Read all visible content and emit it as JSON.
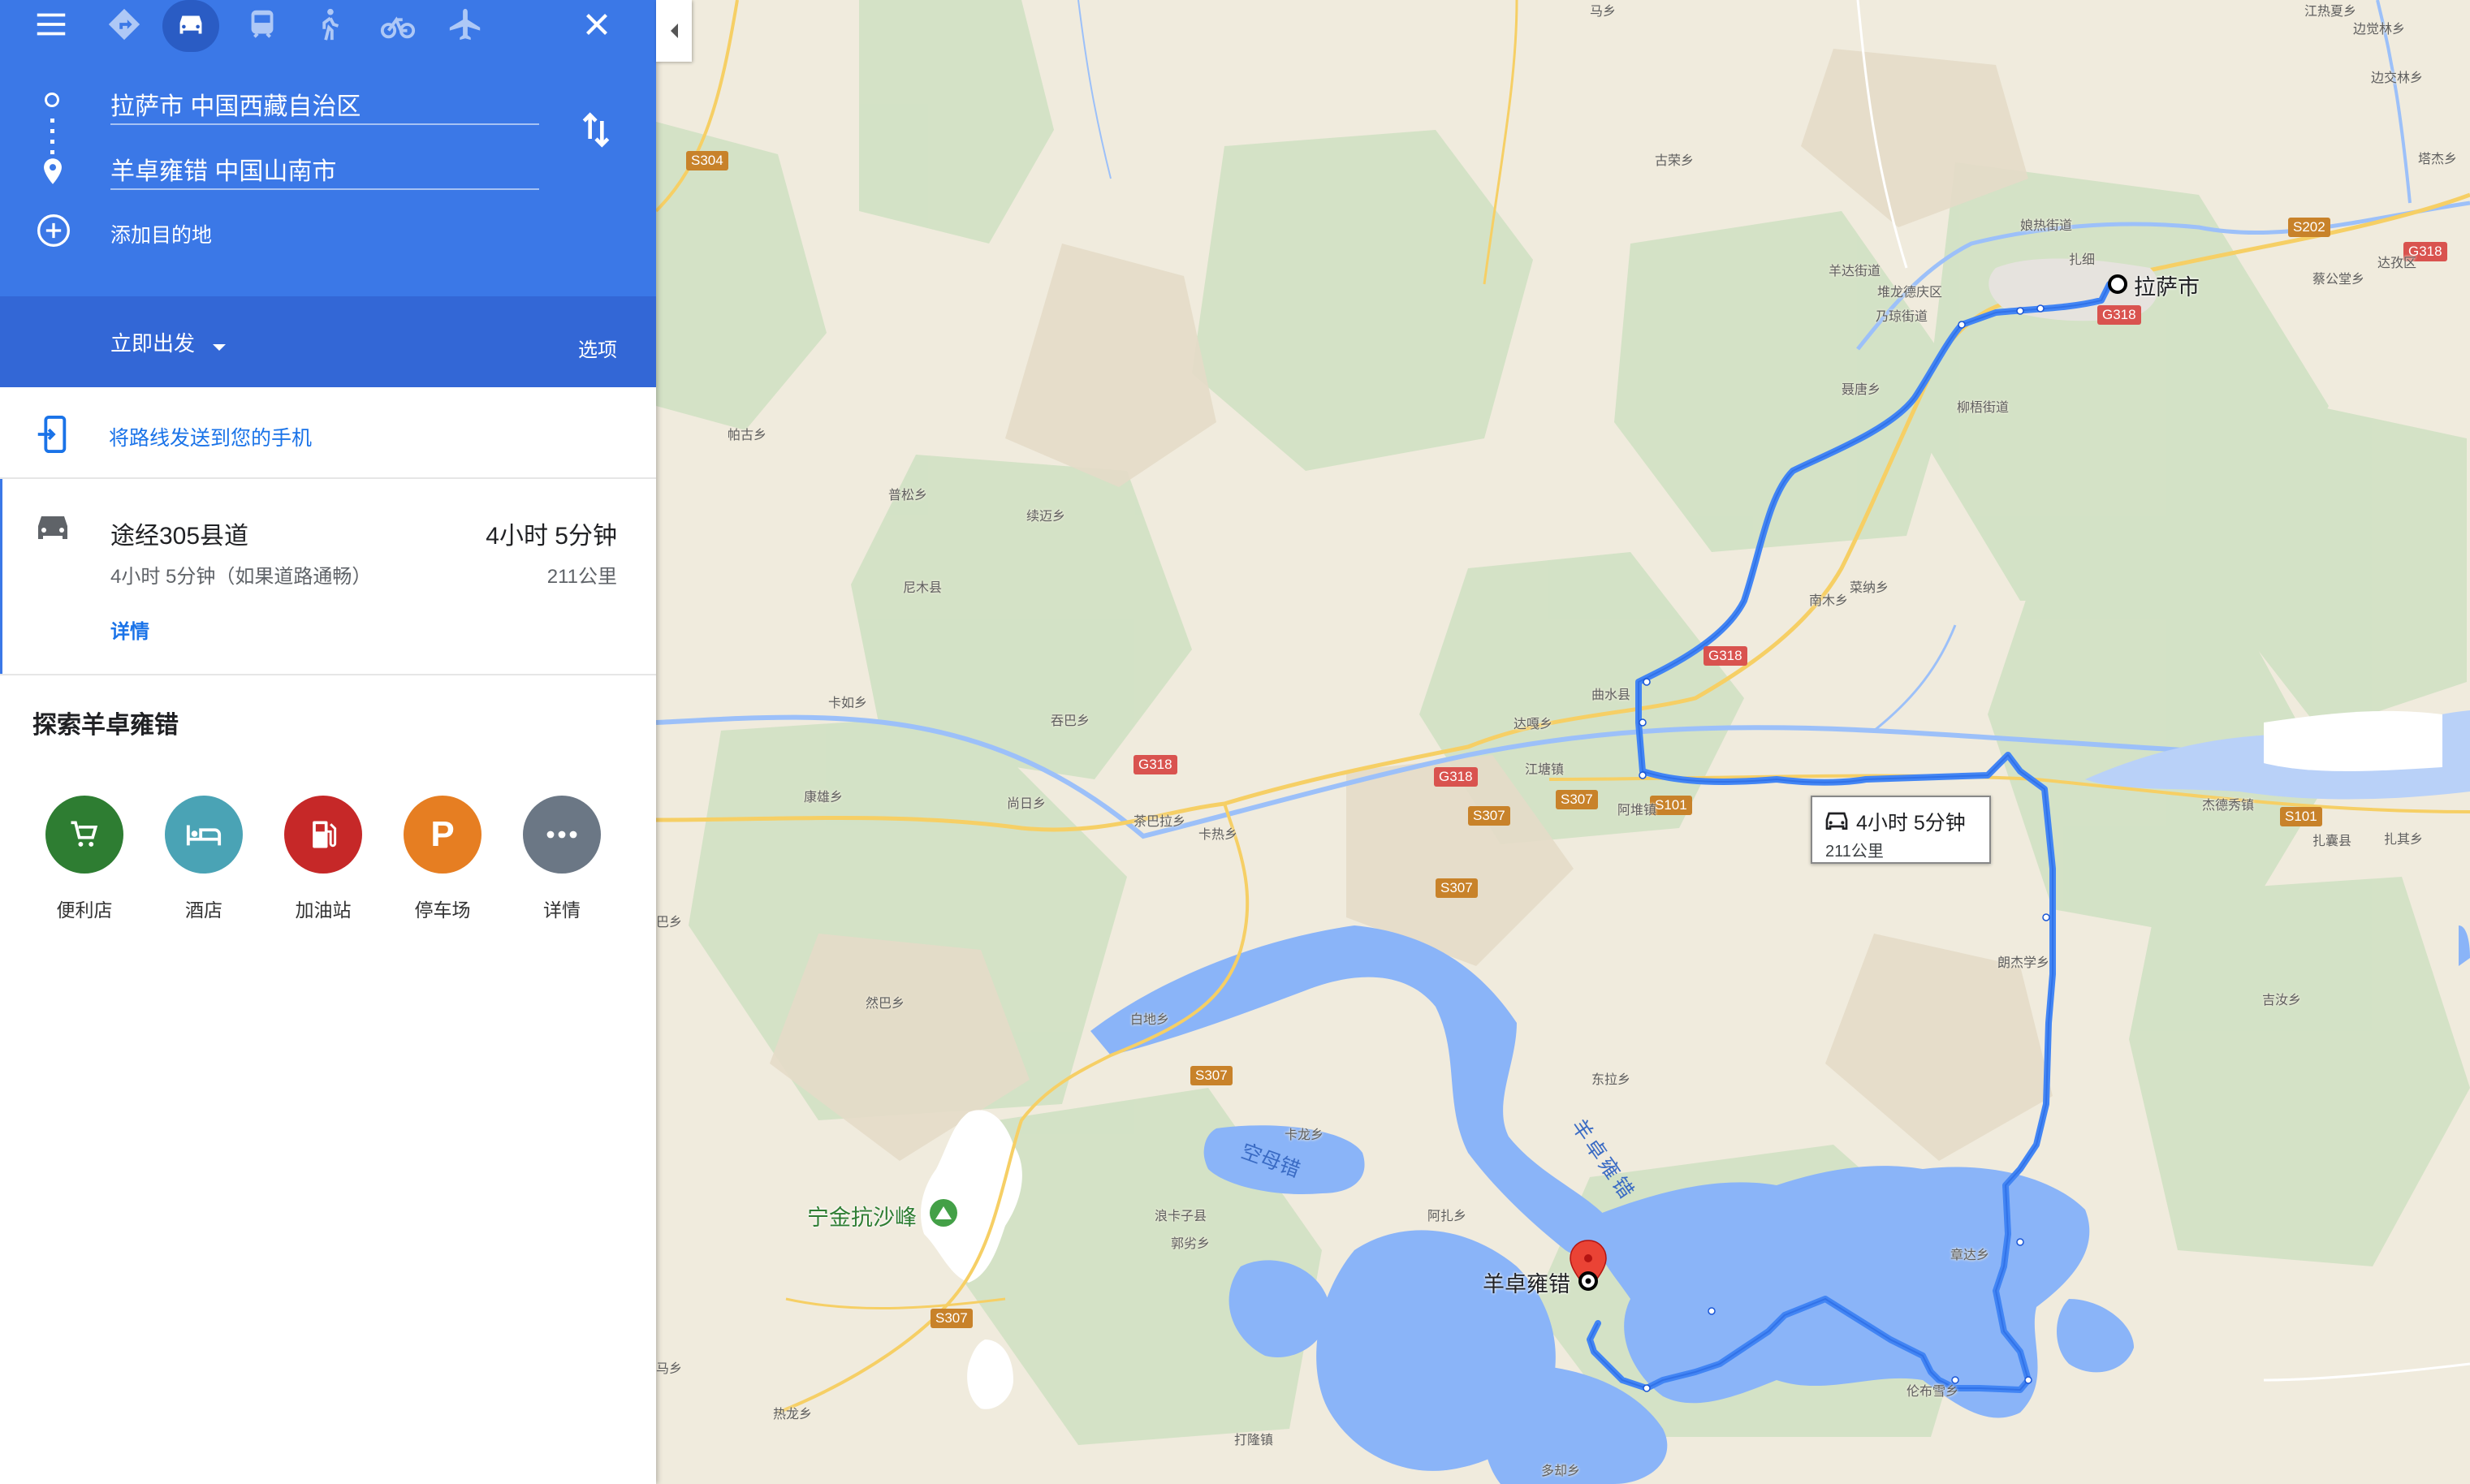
{
  "panel": {
    "menu_icon": "menu-icon",
    "modes": [
      {
        "name": "best-route",
        "icon": "directions-diamond-icon"
      },
      {
        "name": "driving",
        "icon": "car-icon",
        "active": true
      },
      {
        "name": "transit",
        "icon": "transit-icon"
      },
      {
        "name": "walking",
        "icon": "walking-icon"
      },
      {
        "name": "cycling",
        "icon": "bicycle-icon"
      },
      {
        "name": "flight",
        "icon": "airplane-icon"
      }
    ],
    "origin": "拉萨市 中国西藏自治区",
    "destination": "羊卓雍错 中国山南市",
    "add_destination": "添加目的地",
    "depart_label": "立即出发",
    "options_label": "选项",
    "send_to_phone": "将路线发送到您的手机",
    "route": {
      "via": "途经305县道",
      "duration": "4小时 5分钟",
      "detail": "4小时 5分钟（如果道路通畅）",
      "distance": "211公里",
      "details_link": "详情"
    },
    "explore_title": "探索羊卓雍错",
    "categories": [
      {
        "label": "便利店",
        "icon": "cart-icon",
        "color": "#2e7d32"
      },
      {
        "label": "酒店",
        "icon": "bed-icon",
        "color": "#4aa3b5"
      },
      {
        "label": "加油站",
        "icon": "gas-icon",
        "color": "#c62828"
      },
      {
        "label": "停车场",
        "icon": "parking-icon",
        "color": "#e67e22"
      },
      {
        "label": "详情",
        "icon": "more-icon",
        "color": "#6b7785"
      }
    ]
  },
  "map": {
    "route_card": {
      "duration": "4小时 5分钟",
      "distance": "211公里"
    },
    "start_label": "拉萨市",
    "end_label": "羊卓雍错",
    "peak_label": "宁金抗沙峰",
    "lake_labels": [
      "空母错",
      "羊卓雍错"
    ],
    "road_labels": [
      "S304",
      "S202",
      "G318",
      "G318",
      "G318",
      "G318",
      "G318",
      "S307",
      "S101",
      "S101",
      "S307",
      "S307",
      "S307",
      "S307"
    ],
    "place_labels": [
      "马乡",
      "江热夏乡",
      "边觉林乡",
      "边交林乡",
      "塔杰乡",
      "古荣乡",
      "娘热街道",
      "扎细",
      "蔡公堂乡",
      "达孜区",
      "羊达街道",
      "堆龙德庆区",
      "乃琼街道",
      "柳梧街道",
      "聂唐乡",
      "帕古乡",
      "普松乡",
      "续迈乡",
      "尼木县",
      "菜纳乡",
      "南木乡",
      "曲水县",
      "卡如乡",
      "吞巴乡",
      "达嘎乡",
      "江塘镇",
      "康雄乡",
      "尚日乡",
      "茶巴拉乡",
      "卡热乡",
      "阿堆镇",
      "杰德秀镇",
      "扎囊县",
      "扎其乡",
      "朗杰学乡",
      "吉汝乡",
      "巴乡",
      "然巴乡",
      "白地乡",
      "东拉乡",
      "卡龙乡",
      "浪卡子县",
      "阿扎乡",
      "郭劣乡",
      "章达乡",
      "伦布雪乡",
      "马乡",
      "打隆镇",
      "多却乡",
      "热龙乡"
    ]
  }
}
